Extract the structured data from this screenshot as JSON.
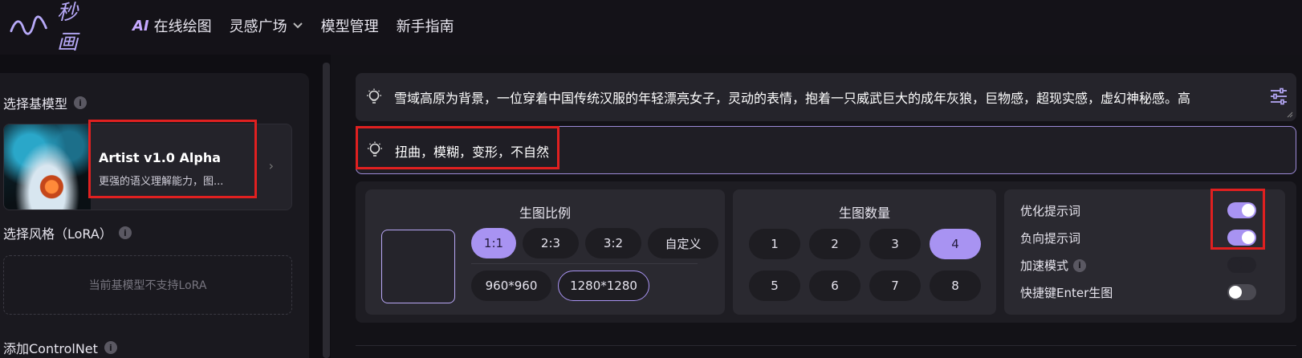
{
  "brand": {
    "logo_text": "秒画"
  },
  "nav": {
    "ai_label": "AI",
    "online_draw": "在线绘图",
    "inspiration": "灵感广场",
    "model_mgmt": "模型管理",
    "guide": "新手指南"
  },
  "left": {
    "base_model_title": "选择基模型",
    "model": {
      "name": "Artist v1.0 Alpha",
      "desc": "更强的语义理解能力，图..."
    },
    "lora_title": "选择风格（LoRA）",
    "lora_empty": "当前基模型不支持LoRA",
    "controlnet_title": "添加ControlNet"
  },
  "prompt": {
    "text": "雪域高原为背景，一位穿着中国传统汉服的年轻漂亮女子，灵动的表情，抱着一只威武巨大的成年灰狼，巨物感，超现实感，虚幻神秘感。高"
  },
  "negative_prompt": {
    "text": "扭曲，模糊，变形，不自然"
  },
  "ratio": {
    "title": "生图比例",
    "options": [
      "1:1",
      "2:3",
      "3:2",
      "自定义"
    ],
    "selected": "1:1",
    "sizes": [
      "960*960",
      "1280*1280"
    ],
    "selected_size": "1280*1280"
  },
  "count": {
    "title": "生图数量",
    "options": [
      "1",
      "2",
      "3",
      "4",
      "5",
      "6",
      "7",
      "8"
    ],
    "selected": "4"
  },
  "switches": [
    {
      "label": "优化提示词",
      "state": "on"
    },
    {
      "label": "负向提示词",
      "state": "on"
    },
    {
      "label": "加速模式",
      "state": "disabled"
    },
    {
      "label": "快捷键Enter生图",
      "state": "off"
    }
  ],
  "colors": {
    "accent": "#a893f2",
    "background": "#0f0e13",
    "panel": "#2a2930",
    "highlight_box": "#e02020"
  }
}
